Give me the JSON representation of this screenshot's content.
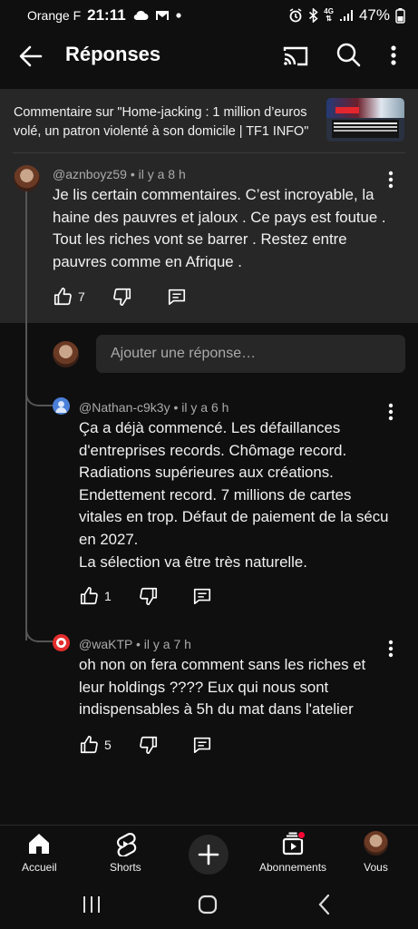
{
  "status_bar": {
    "carrier": "Orange F",
    "time": "21:11",
    "battery": "47%",
    "network": "4G",
    "icons": [
      "cloud-icon",
      "gmail-icon",
      "alarm-icon",
      "bluetooth-icon",
      "signal-icon",
      "battery-icon"
    ]
  },
  "header": {
    "title": "Réponses"
  },
  "video": {
    "text": "Commentaire sur \"Home-jacking : 1 million d’euros volé, un patron violenté à son domicile | TF1 INFO\""
  },
  "main_comment": {
    "author": "@aznboyz59",
    "time": "il y a 8 h",
    "text": "Je lis certain commentaires.  C’est incroyable,  la haine des pauvres et jaloux . Ce pays est foutue . Tout les riches vont se barrer . Restez entre pauvres comme en Afrique .",
    "likes": "7"
  },
  "reply_input": {
    "placeholder": "Ajouter une réponse…"
  },
  "replies": [
    {
      "author": "@Nathan-c9k3y",
      "time": "il y a 6 h",
      "lines": [
        "Ça a déjà commencé. Les défaillances",
        "d'entreprises records. Chômage record.",
        "Radiations supérieures aux créations.",
        "Endettement record. 7 millions de cartes",
        "vitales en trop. Défaut de paiement de la sécu",
        "en 2027.",
        "La sélection va être très naturelle."
      ],
      "likes": "1"
    },
    {
      "author": "@waKTP",
      "time": "il y a 7 h",
      "lines": [
        "oh non on fera comment sans les riches et",
        "leur holdings ???? Eux qui nous sont",
        "indispensables à 5h du mat dans l'atelier"
      ],
      "likes": "5"
    }
  ],
  "bottom_nav": {
    "home": "Accueil",
    "shorts": "Shorts",
    "subscriptions": "Abonnements",
    "you": "Vous"
  },
  "colors": {
    "background": "#0f0f0f",
    "surface": "#272727",
    "text": "#f1f1f1",
    "meta": "#aaaaaa",
    "notification": "#ff0033"
  }
}
